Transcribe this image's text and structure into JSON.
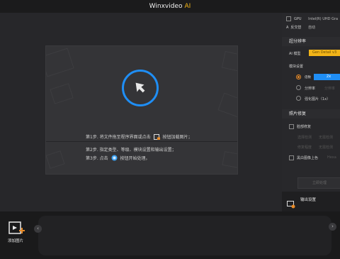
{
  "window": {
    "title_main": "Winxvideo",
    "title_ai": "AI"
  },
  "steps": {
    "step1_before": "第1步. 将文件拖至程序界面或点击",
    "step1_after": "按钮加载图片；",
    "step2": "第2步. 指定类型、等级、模块设置和输出设置；",
    "step3_before": "第3步. 点击",
    "step3_after": "按钮开始处理。"
  },
  "sidebar": {
    "gpu_label": "GPU",
    "gpu_value": "Intel(R) UHD Gra",
    "backend_label": "反交替",
    "backend_value": "自动",
    "upscale_header": "超分辨率",
    "ai_model_label": "AI 模型",
    "ai_model_value": "Gen Detail v3",
    "module_label": "模块设置",
    "scale_label": "倍数",
    "scale_value": "2x",
    "resolution_label": "分辨率",
    "resolution_value": "分辨率",
    "enhance_label": "强化图片（1x）",
    "repair_header": "照片修复",
    "denoise_label": "脸部修复",
    "denoise_sub1": "选择检测",
    "denoise_sub1_value": "无需检测",
    "denoise_sub2": "修复程度",
    "denoise_sub2_value": "无需检测",
    "colorize_label": "黑白图像上色",
    "colorize_value": "Hexa",
    "disabled_btn": "立即处理",
    "output_label": "输出设置"
  },
  "bottom": {
    "add_image_label": "添加图片",
    "prev": "‹",
    "next": "›"
  },
  "colors": {
    "accent_blue": "#1f8ef5",
    "accent_yellow": "#f2b418",
    "accent_orange": "#e98b27"
  }
}
